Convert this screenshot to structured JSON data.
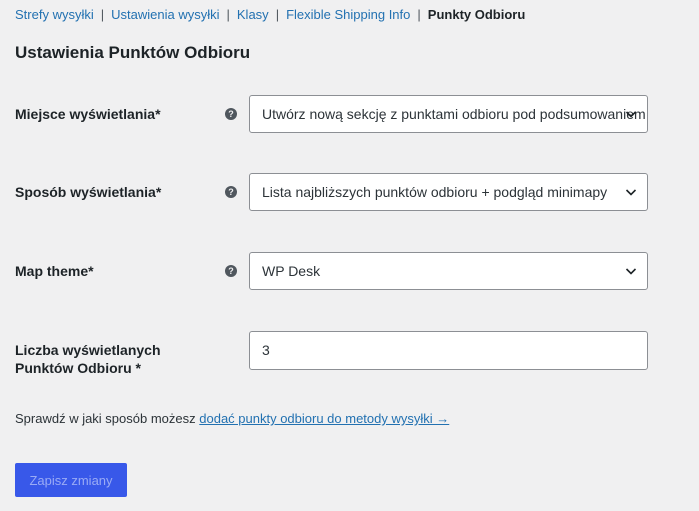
{
  "nav": {
    "links": [
      "Strefy wysyłki",
      "Ustawienia wysyłki",
      "Klasy",
      "Flexible Shipping Info"
    ],
    "current": "Punkty Odbioru",
    "separator": "|"
  },
  "section": {
    "title": "Ustawienia Punktów Odbioru"
  },
  "fields": {
    "display_place": {
      "label": "Miejsce wyświetlania*",
      "value": "Utwórz nową sekcję z punktami odbioru pod podsumowaniem"
    },
    "display_mode": {
      "label": "Sposób wyświetlania*",
      "value": "Lista najbliższych punktów odbioru + podgląd minimapy"
    },
    "map_theme": {
      "label": "Map theme*",
      "value": "WP Desk"
    },
    "points_count": {
      "label_line1": "Liczba wyświetlanych",
      "label_line2": "Punktów Odbioru *",
      "value": "3"
    },
    "help_glyph": "?"
  },
  "note": {
    "text": "Sprawdź w jaki sposób możesz ",
    "link": "dodać punkty odbioru do metody wysyłki →"
  },
  "save_button": {
    "label": "Zapisz zmiany"
  },
  "colors": {
    "link": "#2271b1",
    "button": "#3858e9",
    "button_text": "#9aabf5",
    "background": "#f0f0f1"
  },
  "icons": {
    "help": "question-circle-icon",
    "dropdown": "chevron-down-icon"
  }
}
